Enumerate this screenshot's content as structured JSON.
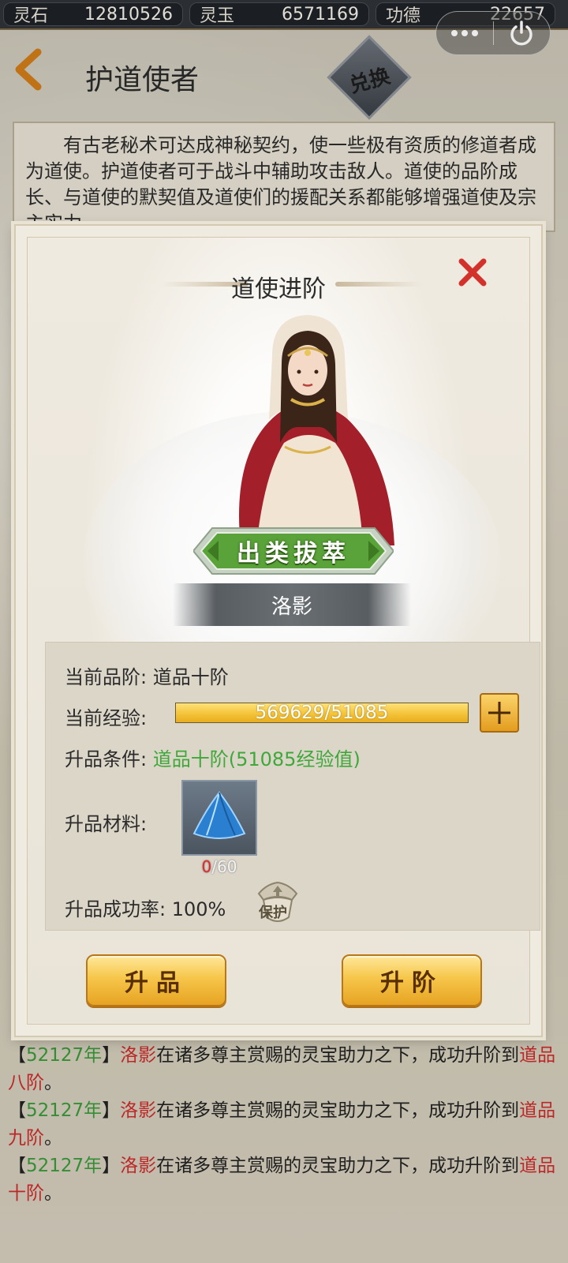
{
  "topbar": {
    "resources": [
      {
        "label": "灵石",
        "value": "12810526"
      },
      {
        "label": "灵玉",
        "value": "6571169"
      },
      {
        "label": "功德",
        "value": "22657"
      }
    ]
  },
  "capsule": {
    "more_icon": "ellipsis-icon",
    "close_icon": "power-icon"
  },
  "header": {
    "title": "护道使者",
    "exchange_label": "兑换"
  },
  "description": "有古老秘术可达成神秘契约，使一些极有资质的修道者成为道使。护道使者可于战斗中辅助攻击敌人。道使的品阶成长、与道使的默契值及道使们的援配关系都能够增强道使及宗主实力。",
  "modal": {
    "title": "道使进阶",
    "rank_badge": "出类拔萃",
    "character_name": "洛影",
    "current_rank_label": "当前品阶:",
    "current_rank_value": "道品十阶",
    "exp_label": "当前经验:",
    "exp_text": "569629/51085",
    "exp_progress": 1.0,
    "condition_label": "升品条件:",
    "condition_value": "道品十阶(51085经验值)",
    "material_label": "升品材料:",
    "material_have": "0",
    "material_need": "/60",
    "success_label": "升品成功率:",
    "success_value": "100%",
    "protect_label": "保护",
    "btn_upgrade_grade": "升品",
    "btn_upgrade_rank": "升阶",
    "colors": {
      "accent_green": "#3fa83a",
      "accent_red": "#e12b2b",
      "gold": "#f4c43a"
    }
  },
  "log": [
    {
      "pre": "【",
      "year": "52127年",
      "mid": "】",
      "name": "洛影",
      "text": "在诸多尊主赏赐的灵宝助力之下，成功升阶到",
      "rank": "道品八阶",
      "end": "。"
    },
    {
      "pre": "【",
      "year": "52127年",
      "mid": "】",
      "name": "洛影",
      "text": "在诸多尊主赏赐的灵宝助力之下，成功升阶到",
      "rank": "道品九阶",
      "end": "。"
    },
    {
      "pre": "【",
      "year": "52127年",
      "mid": "】",
      "name": "洛影",
      "text": "在诸多尊主赏赐的灵宝助力之下，成功升阶到",
      "rank": "道品十阶",
      "end": "。"
    }
  ]
}
